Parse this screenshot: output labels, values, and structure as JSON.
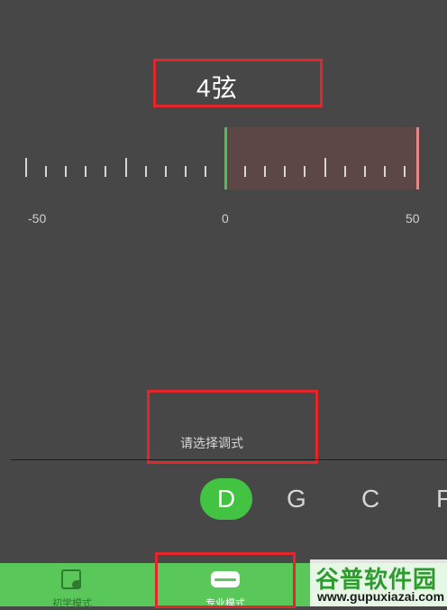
{
  "header": {
    "string_label": "4弦"
  },
  "scale": {
    "min_label": "-50",
    "zero_label": "0",
    "max_label": "50"
  },
  "tuning_selector": {
    "prompt": "请选择调式",
    "options": [
      "D",
      "G",
      "C",
      "F"
    ],
    "selected": "D"
  },
  "tabbar": {
    "beginner_label": "初学模式",
    "pro_label": "专业模式",
    "beginner_icon": "leaf-note-icon",
    "pro_icon": "tuner-card-icon"
  },
  "watermark": {
    "main": "谷普软件园",
    "url": "www.gupuxiazai.com"
  },
  "colors": {
    "accent": "#42c342",
    "highlight_box": "#e2262b",
    "background": "#474747"
  }
}
